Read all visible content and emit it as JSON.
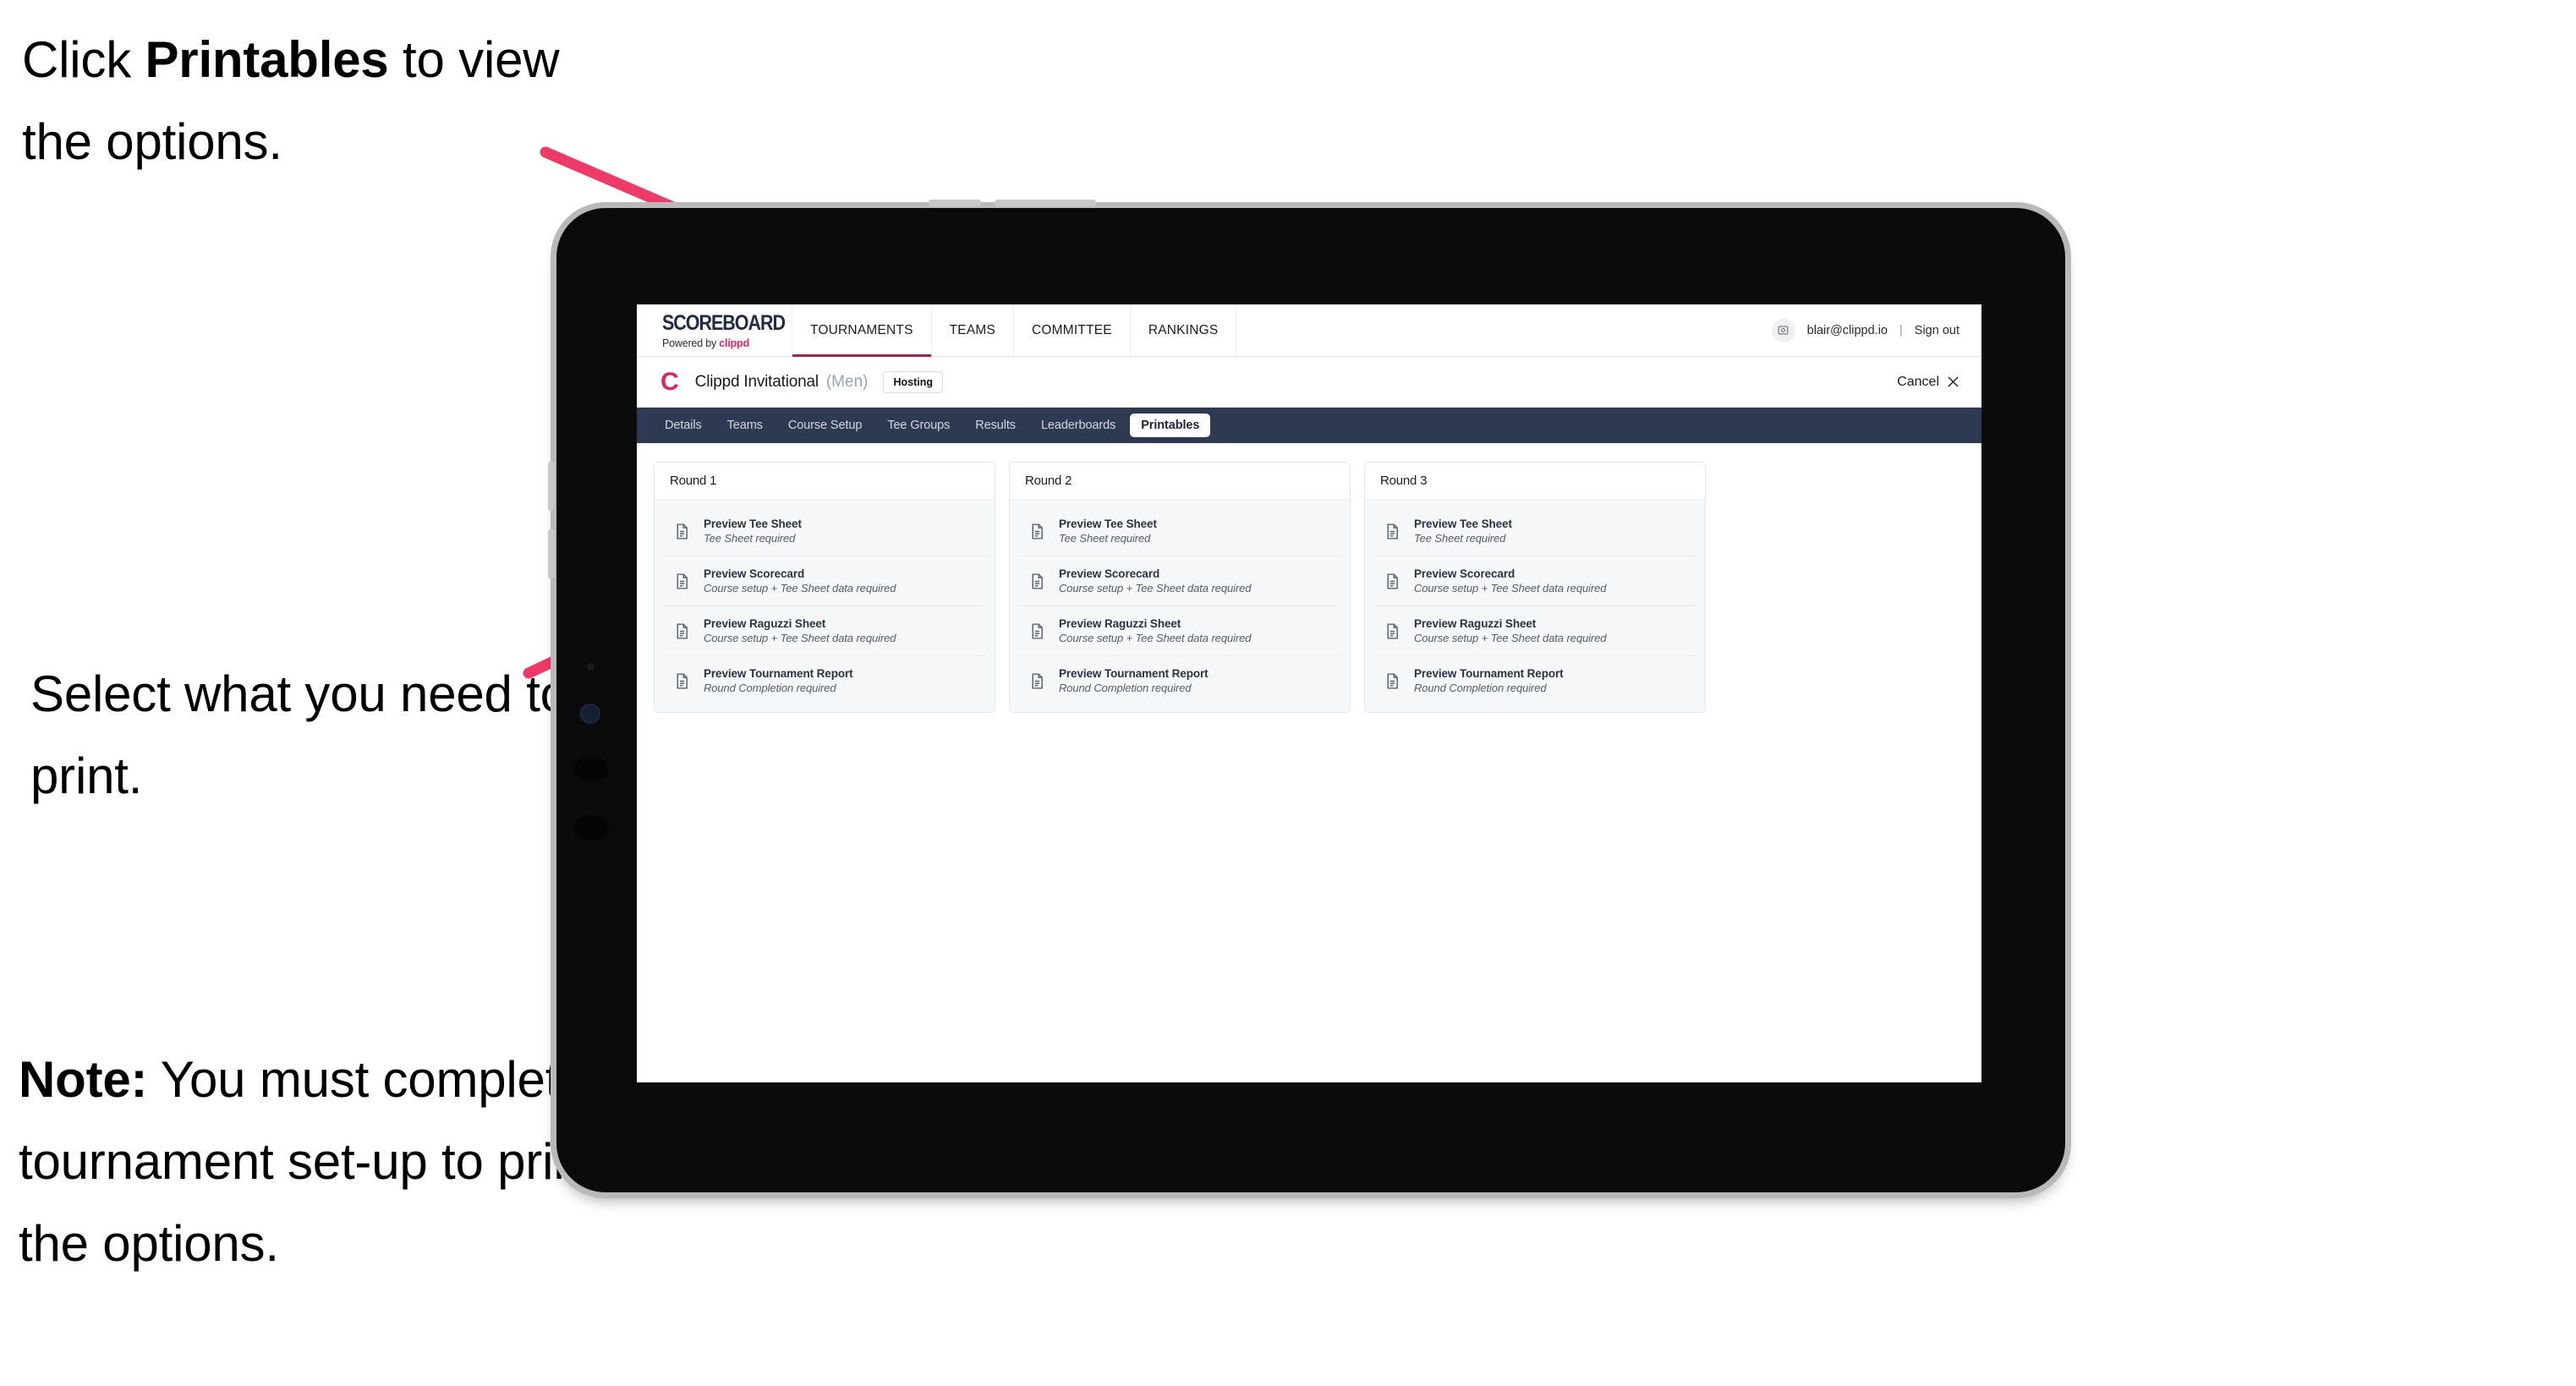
{
  "annotations": {
    "top": {
      "pre": "Click ",
      "bold": "Printables",
      "post": " to view the options."
    },
    "middle": {
      "text": "Select what you need to print."
    },
    "note": {
      "bold": "Note:",
      "text": " You must complete the tournament set-up to print all the options."
    }
  },
  "colors": {
    "arrow_pink": "#ef3a67",
    "brand_pink": "#e6245e",
    "tabstrip_navy": "#2e3a51",
    "tab_underline": "#a2234a",
    "device_black": "#0b0b0b",
    "device_bezel": "#b9b9b9"
  },
  "app": {
    "brand": {
      "name": "SCOREBOARD",
      "tagline_prefix": "Powered by ",
      "tagline_brand": "clippd"
    },
    "top_nav": [
      {
        "label": "TOURNAMENTS",
        "active": true
      },
      {
        "label": "TEAMS",
        "active": false
      },
      {
        "label": "COMMITTEE",
        "active": false
      },
      {
        "label": "RANKINGS",
        "active": false
      }
    ],
    "account": {
      "avatar_icon": "user-avatar-icon",
      "email": "blair@clippd.io",
      "separator": "|",
      "sign_out_label": "Sign out"
    },
    "tournament": {
      "logo_letter": "C",
      "name": "Clippd Invitational",
      "gender": "(Men)",
      "status_badge": "Hosting",
      "cancel_label": "Cancel",
      "cancel_icon": "close-x-icon"
    },
    "tabs": [
      {
        "label": "Details",
        "active": false
      },
      {
        "label": "Teams",
        "active": false
      },
      {
        "label": "Course Setup",
        "active": false
      },
      {
        "label": "Tee Groups",
        "active": false
      },
      {
        "label": "Results",
        "active": false
      },
      {
        "label": "Leaderboards",
        "active": false
      },
      {
        "label": "Printables",
        "active": true
      }
    ],
    "rounds": [
      {
        "title": "Round 1",
        "items": [
          {
            "title": "Preview Tee Sheet",
            "requirement": "Tee Sheet required",
            "icon": "document-icon"
          },
          {
            "title": "Preview Scorecard",
            "requirement": "Course setup + Tee Sheet data required",
            "icon": "document-icon"
          },
          {
            "title": "Preview Raguzzi Sheet",
            "requirement": "Course setup + Tee Sheet data required",
            "icon": "document-icon"
          },
          {
            "title": "Preview Tournament Report",
            "requirement": "Round Completion required",
            "icon": "document-icon"
          }
        ]
      },
      {
        "title": "Round 2",
        "items": [
          {
            "title": "Preview Tee Sheet",
            "requirement": "Tee Sheet required",
            "icon": "document-icon"
          },
          {
            "title": "Preview Scorecard",
            "requirement": "Course setup + Tee Sheet data required",
            "icon": "document-icon"
          },
          {
            "title": "Preview Raguzzi Sheet",
            "requirement": "Course setup + Tee Sheet data required",
            "icon": "document-icon"
          },
          {
            "title": "Preview Tournament Report",
            "requirement": "Round Completion required",
            "icon": "document-icon"
          }
        ]
      },
      {
        "title": "Round 3",
        "items": [
          {
            "title": "Preview Tee Sheet",
            "requirement": "Tee Sheet required",
            "icon": "document-icon"
          },
          {
            "title": "Preview Scorecard",
            "requirement": "Course setup + Tee Sheet data required",
            "icon": "document-icon"
          },
          {
            "title": "Preview Raguzzi Sheet",
            "requirement": "Course setup + Tee Sheet data required",
            "icon": "document-icon"
          },
          {
            "title": "Preview Tournament Report",
            "requirement": "Round Completion required",
            "icon": "document-icon"
          }
        ]
      }
    ]
  }
}
